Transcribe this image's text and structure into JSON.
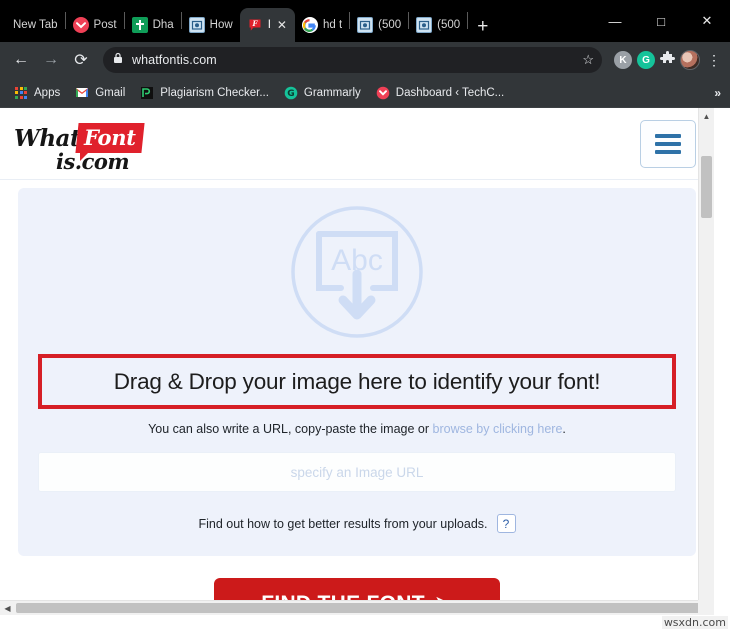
{
  "browser": {
    "tabs": [
      {
        "title": "New Tab",
        "icon": "none",
        "active": false
      },
      {
        "title": "Post",
        "icon": "pocket-icon",
        "active": false
      },
      {
        "title": "Dha",
        "icon": "sheets-icon",
        "active": false
      },
      {
        "title": "How",
        "icon": "photo-icon",
        "active": false
      },
      {
        "title": "I",
        "icon": "whatfontis-icon",
        "active": true
      },
      {
        "title": "hd t",
        "icon": "google-icon",
        "active": false
      },
      {
        "title": "(500",
        "icon": "photo-icon",
        "active": false
      },
      {
        "title": "(500",
        "icon": "photo-icon",
        "active": false
      }
    ],
    "new_tab_label": "+",
    "window_controls": {
      "minimize": "—",
      "maximize": "□",
      "close": "✕"
    },
    "nav": {
      "back": "←",
      "forward": "→",
      "reload": "⟳",
      "lock_icon": "lock-icon",
      "url": "whatfontis.com",
      "star": "☆",
      "profile_k": "K",
      "grammarly": "G",
      "puzzle": "🧩",
      "kebab": "⋮"
    },
    "bookmarks": [
      {
        "label": "Apps",
        "icon": "apps-grid-icon"
      },
      {
        "label": "Gmail",
        "icon": "gmail-icon"
      },
      {
        "label": "Plagiarism Checker...",
        "icon": "plagiarism-icon"
      },
      {
        "label": "Grammarly",
        "icon": "grammarly-icon"
      },
      {
        "label": "Dashboard ‹ TechC...",
        "icon": "pocket-icon"
      }
    ],
    "bookmarks_overflow": "»"
  },
  "site": {
    "logo": {
      "part1": "What",
      "part2": "Font",
      "part3": "is.com"
    },
    "menu_button": "hamburger-menu",
    "upload": {
      "icon_text": "Abc",
      "headline": "Drag & Drop your image here to identify your font!",
      "hint_prefix": "You can also write a URL, copy-paste the image or ",
      "hint_link": "browse by clicking here",
      "hint_suffix": ".",
      "url_placeholder": "specify an Image URL",
      "url_value": "",
      "better_results_text": "Find out how to get better results from your uploads.",
      "help_badge": "?",
      "submit_label": "FIND THE FONT",
      "submit_arrow": "➤"
    }
  },
  "scrollbars": {
    "v_up": "▲",
    "v_down": "▼",
    "h_left": "◀"
  },
  "watermark": "wsxdn.com",
  "colors": {
    "brand_red": "#e0212c",
    "button_red": "#cc1a1a",
    "highlight_red": "#d61f26",
    "panel_blue": "#eef2fb",
    "link_blue": "#9fb6e0",
    "chrome_dark": "#323639"
  }
}
